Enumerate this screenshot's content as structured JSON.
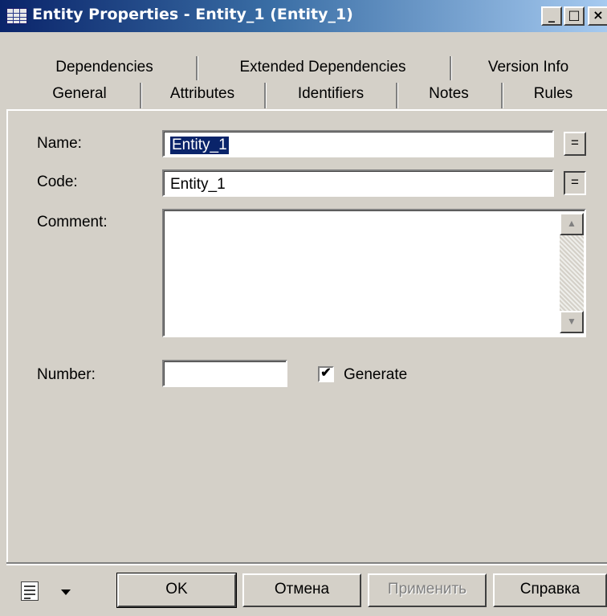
{
  "window": {
    "title": "Entity Properties - Entity_1 (Entity_1)",
    "icon": "table-icon",
    "controls": {
      "minimize": "_",
      "maximize": "□",
      "close": "×"
    }
  },
  "tabs": {
    "row1": [
      "Dependencies",
      "Extended Dependencies",
      "Version Info"
    ],
    "row2": [
      "General",
      "Attributes",
      "Identifiers",
      "Notes",
      "Rules"
    ],
    "active": "General"
  },
  "form": {
    "name_label": "Name:",
    "name_value": "Entity_1",
    "name_button": "=",
    "code_label": "Code:",
    "code_value": "Entity_1",
    "code_button": "=",
    "comment_label": "Comment:",
    "comment_value": "",
    "number_label": "Number:",
    "number_value": "",
    "generate_label": "Generate",
    "generate_checked": true,
    "check_mark": "✔"
  },
  "buttons": {
    "ok": "OK",
    "cancel": "Отмена",
    "apply": "Применить",
    "help": "Справка"
  },
  "colors": {
    "title_bar": "#0a246a",
    "dialog_bg": "#d4d0c8",
    "selection": "#0a246a"
  }
}
